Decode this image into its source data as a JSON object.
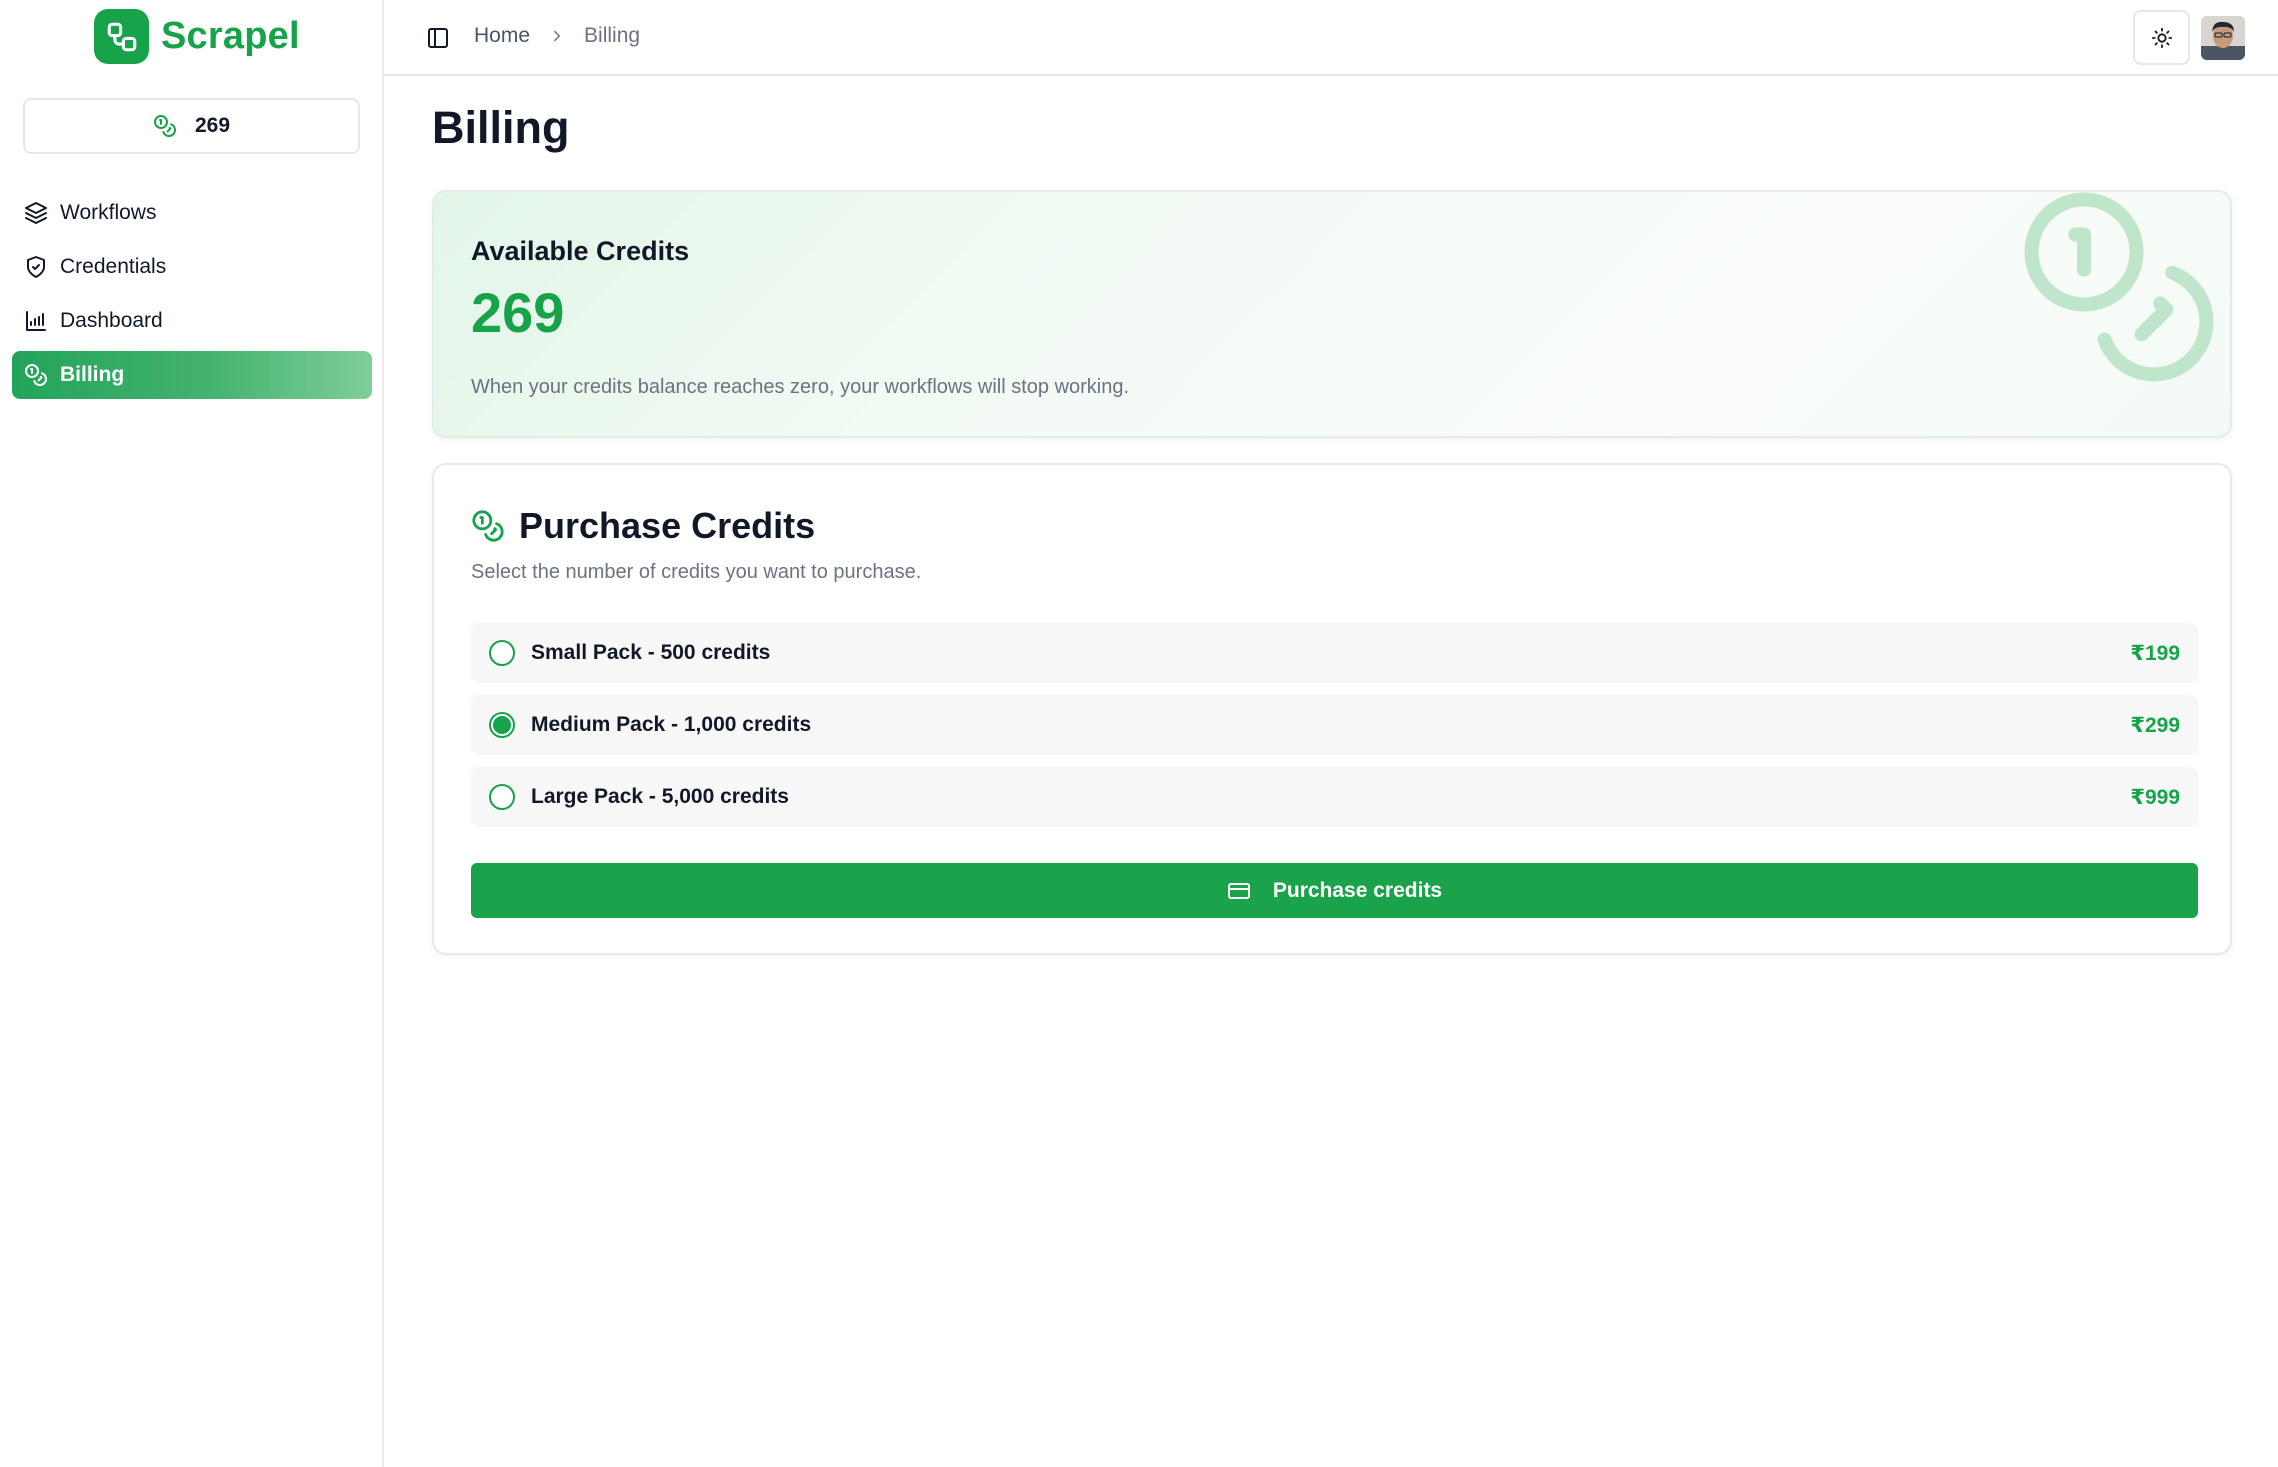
{
  "app": {
    "name": "Scrapel",
    "brand_color": "#16a34a"
  },
  "sidebar": {
    "credits": "269",
    "items": [
      {
        "label": "Workflows",
        "icon": "layers-icon",
        "active": false
      },
      {
        "label": "Credentials",
        "icon": "shield-check-icon",
        "active": false
      },
      {
        "label": "Dashboard",
        "icon": "bar-chart-icon",
        "active": false
      },
      {
        "label": "Billing",
        "icon": "coins-icon",
        "active": true
      }
    ]
  },
  "header": {
    "breadcrumb": [
      "Home",
      "Billing"
    ],
    "theme_toggle_icon": "sun-icon",
    "avatar_icon": "user-avatar"
  },
  "page": {
    "title": "Billing"
  },
  "available": {
    "title": "Available Credits",
    "value": "269",
    "note": "When your credits balance reaches zero, your workflows will stop working."
  },
  "purchase": {
    "title": "Purchase Credits",
    "subtitle": "Select the number of credits you want to purchase.",
    "packs": [
      {
        "label": "Small Pack - 500 credits",
        "price": "₹199",
        "selected": false
      },
      {
        "label": "Medium Pack - 1,000 credits",
        "price": "₹299",
        "selected": true
      },
      {
        "label": "Large Pack - 5,000 credits",
        "price": "₹999",
        "selected": false
      }
    ],
    "button_label": "Purchase credits",
    "button_icon": "credit-card-icon"
  }
}
